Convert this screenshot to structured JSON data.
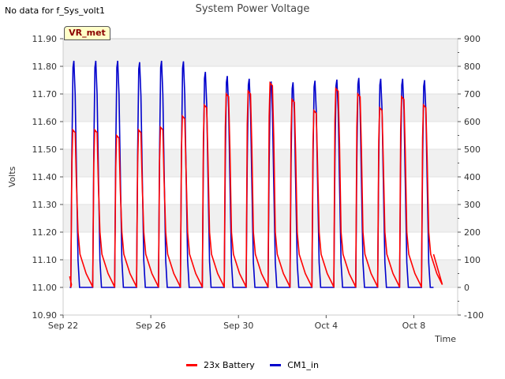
{
  "header": {
    "note": "No data for f_Sys_volt1",
    "title": "System Power Voltage",
    "site_tag": "VR_met"
  },
  "chart_data": {
    "type": "line",
    "title": "System Power Voltage",
    "xlabel": "Time",
    "ylabel": "Volts",
    "x_ticks": [
      "Sep 22",
      "Sep 26",
      "Sep 30",
      "Oct 4",
      "Oct 8"
    ],
    "x_range_days": [
      0,
      18
    ],
    "ylim_left": [
      10.9,
      11.9
    ],
    "y_ticks_left": [
      "10.90",
      "11.00",
      "11.10",
      "11.20",
      "11.30",
      "11.40",
      "11.50",
      "11.60",
      "11.70",
      "11.80",
      "11.90"
    ],
    "ylim_right": [
      -100,
      900
    ],
    "y_ticks_right": [
      "-100",
      "0",
      "100",
      "200",
      "300",
      "400",
      "500",
      "600",
      "700",
      "800",
      "900"
    ],
    "grid": true,
    "legend_position": "bottom",
    "series": [
      {
        "name": "23x Battery",
        "axis": "left",
        "color": "#ff0000",
        "daily_peak_volts": [
          11.57,
          11.57,
          11.55,
          11.57,
          11.58,
          11.62,
          11.66,
          11.7,
          11.71,
          11.74,
          11.68,
          11.64,
          11.72,
          11.7,
          11.65,
          11.69,
          11.66
        ],
        "night_min_volts": 11.0,
        "start_volts": 11.04
      },
      {
        "name": "CM1_in",
        "axis": "right",
        "color": "#0000cc",
        "daily_peak": [
          820,
          820,
          820,
          815,
          820,
          818,
          780,
          765,
          755,
          745,
          742,
          748,
          752,
          758,
          755,
          755,
          750
        ],
        "night_value": 0
      }
    ]
  }
}
